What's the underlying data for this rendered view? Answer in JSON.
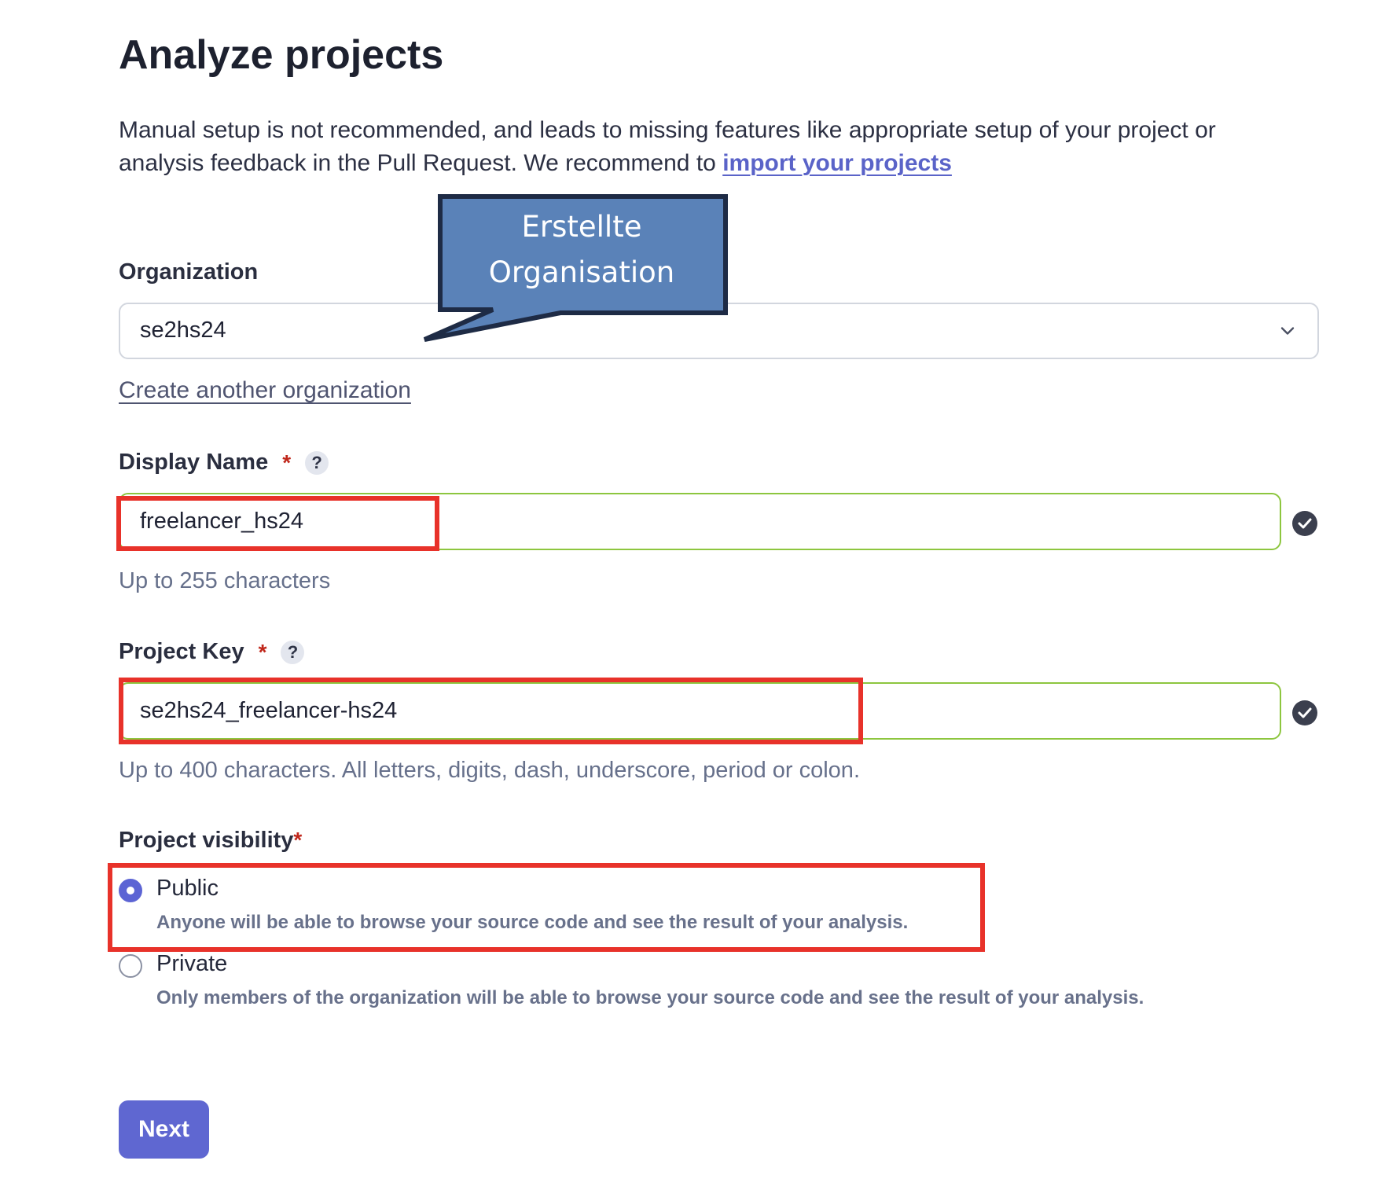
{
  "page": {
    "title": "Analyze projects",
    "intro_text": "Manual setup is not recommended, and leads to missing features like appropriate setup of your project or analysis feedback in the Pull Request. We recommend to",
    "intro_link": "import your projects"
  },
  "organization": {
    "label": "Organization",
    "selected": "se2hs24",
    "create_link": "Create another organization"
  },
  "callout": {
    "line1": "Erstellte",
    "line2": "Organisation"
  },
  "display_name": {
    "label": "Display Name",
    "required_marker": "*",
    "help": "?",
    "value": "freelancer_hs24",
    "hint": "Up to 255 characters"
  },
  "project_key": {
    "label": "Project Key",
    "required_marker": "*",
    "help": "?",
    "value": "se2hs24_freelancer-hs24",
    "hint": "Up to 400 characters. All letters, digits, dash, underscore, period or colon."
  },
  "visibility": {
    "label": "Project visibility",
    "required_marker": "*",
    "options": [
      {
        "label": "Public",
        "description": "Anyone will be able to browse your source code and see the result of your analysis.",
        "selected": true
      },
      {
        "label": "Private",
        "description": "Only members of the organization will be able to browse your source code and see the result of your analysis.",
        "selected": false
      }
    ]
  },
  "actions": {
    "next_label": "Next"
  },
  "colors": {
    "accent": "#5f67d1",
    "valid_border": "#8dc63f",
    "required": "#c0271b",
    "highlight": "#e8322a",
    "callout_fill": "#5a82b8",
    "callout_border": "#1e2b45"
  }
}
